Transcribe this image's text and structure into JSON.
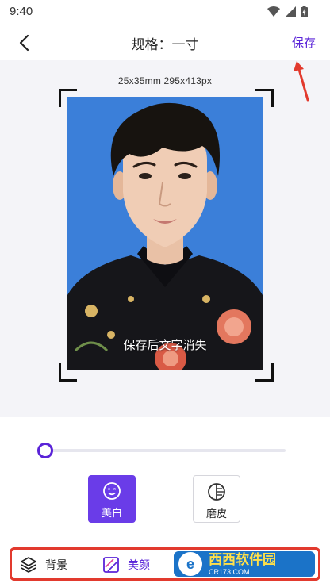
{
  "status": {
    "time": "9:40"
  },
  "header": {
    "title": "规格：一寸",
    "save_label": "保存"
  },
  "preview": {
    "size_label": "25x35mm 295x413px",
    "overlay_text": "保存后文字消失",
    "background_color": "#3b7fd9"
  },
  "slider": {
    "value": 0
  },
  "tools": [
    {
      "label": "美白",
      "icon": "smile-face-icon",
      "selected": true
    },
    {
      "label": "磨皮",
      "icon": "half-circle-icon",
      "selected": false
    }
  ],
  "tabs": [
    {
      "label": "背景",
      "icon": "layers-icon"
    },
    {
      "label": "美颜",
      "icon": "beauty-icon",
      "active": true
    }
  ],
  "watermark": {
    "title": "西西软件园",
    "subtitle": "CR173.COM"
  },
  "colors": {
    "accent": "#5a23d8",
    "annotation": "#e23a2e"
  }
}
